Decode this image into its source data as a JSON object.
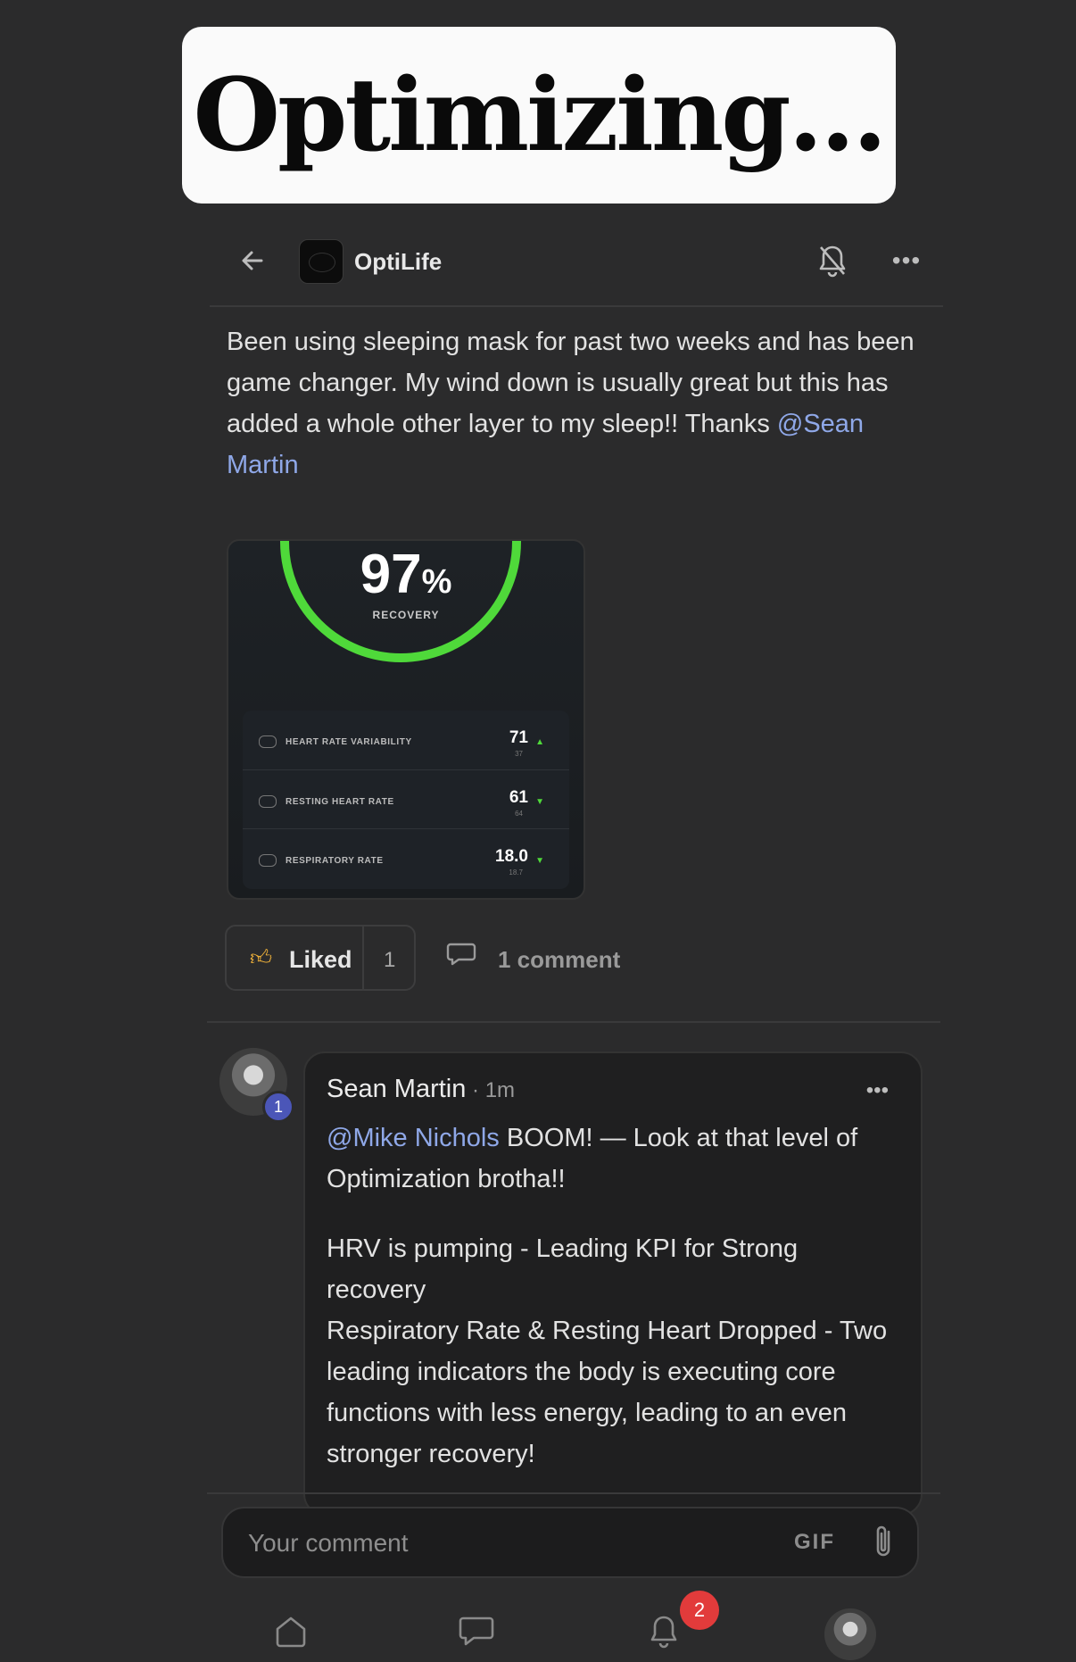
{
  "banner": {
    "text": "Optimizing..."
  },
  "header": {
    "app_name": "OptiLife",
    "more_label": "•••"
  },
  "post": {
    "text": "Been using sleeping mask for past two weeks and has been game changer. My wind down is usually great but this has added a whole other layer to my sleep!! Thanks ",
    "mention": "@Sean Martin",
    "image": {
      "recovery_value": "97",
      "recovery_unit": "%",
      "recovery_label": "RECOVERY",
      "recovery_fraction": 0.97,
      "ring_color": "#4fd93a",
      "metrics": [
        {
          "label": "HEART RATE VARIABILITY",
          "value": "71",
          "sub": "37",
          "icon": "hrv-icon"
        },
        {
          "label": "RESTING HEART RATE",
          "value": "61",
          "sub": "64",
          "icon": "heart-icon"
        },
        {
          "label": "RESPIRATORY RATE",
          "value": "18.0",
          "sub": "18.7",
          "icon": "lungs-icon"
        }
      ]
    },
    "actions": {
      "liked_label": "Liked",
      "like_count": "1",
      "comment_label": "1 comment"
    }
  },
  "comment": {
    "author": "Sean Martin",
    "time": " · 1m",
    "avatar_badge": "1",
    "more_label": "•••",
    "mention": "@Mike Nichols",
    "line1": " BOOM! — Look at that level of Optimization brotha!!",
    "para2": "HRV is pumping - Leading KPI for Strong recovery",
    "para3": "Respiratory Rate & Resting Heart Dropped - Two leading indicators the body is executing core functions with less energy, leading to an even stronger recovery!"
  },
  "composer": {
    "placeholder": "Your comment",
    "gif_label": "GIF"
  },
  "nav": {
    "notification_count": "2"
  },
  "colors": {
    "accent": "#8fa8e8",
    "like": "#f2b33a",
    "badge": "#e23b3b",
    "avatar_badge": "#4b56b8"
  }
}
